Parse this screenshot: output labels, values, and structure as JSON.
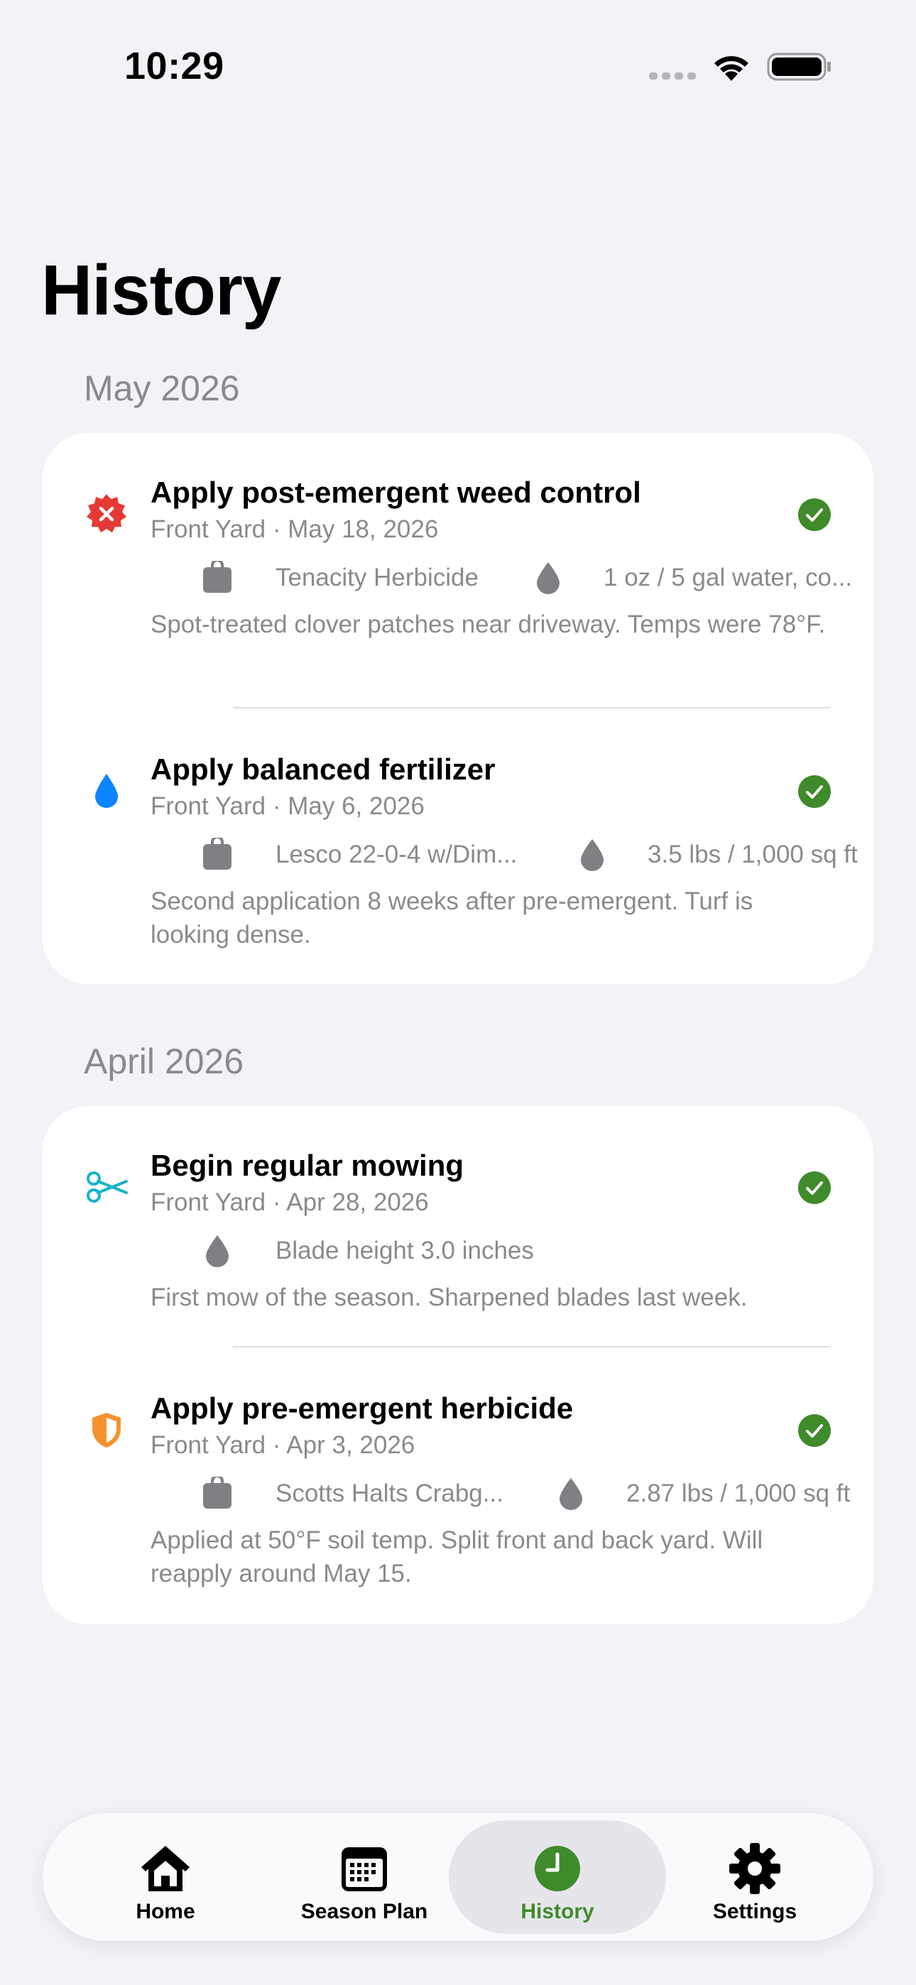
{
  "status_bar": {
    "time": "10:29"
  },
  "title": "History",
  "sections": [
    {
      "header": "May 2026",
      "entries": [
        {
          "icon": "weed-control-icon",
          "title": "Apply post-emergent weed control",
          "subtitle": "Front Yard · May 18, 2026",
          "product": "Tenacity Herbicide",
          "rate": "1 oz / 5 gal water, co...",
          "note": "Spot-treated clover patches near driveway. Temps were 78°F.",
          "status": "completed"
        },
        {
          "icon": "fertilizer-drop-icon",
          "title": "Apply balanced fertilizer",
          "subtitle": "Front Yard · May 6, 2026",
          "product": "Lesco 22-0-4 w/Dim...",
          "rate": "3.5 lbs / 1,000 sq ft",
          "note": "Second application 8 weeks after pre-emergent. Turf is looking dense.",
          "status": "completed"
        }
      ]
    },
    {
      "header": "April 2026",
      "entries": [
        {
          "icon": "scissors-icon",
          "title": "Begin regular mowing",
          "subtitle": "Front Yard · Apr 28, 2026",
          "rate": "Blade height 3.0 inches",
          "note": "First mow of the season. Sharpened blades last week.",
          "status": "completed"
        },
        {
          "icon": "shield-icon",
          "title": "Apply pre-emergent herbicide",
          "subtitle": "Front Yard · Apr 3, 2026",
          "product": "Scotts Halts Crabg...",
          "rate": "2.87 lbs / 1,000 sq ft",
          "note": "Applied at 50°F soil temp. Split front and back yard. Will reapply around May 15.",
          "status": "completed"
        }
      ]
    }
  ],
  "tabs": [
    {
      "label": "Home",
      "icon": "house-icon"
    },
    {
      "label": "Season Plan",
      "icon": "calendar-icon"
    },
    {
      "label": "History",
      "icon": "clock-icon",
      "selected": true
    },
    {
      "label": "Settings",
      "icon": "gear-icon"
    }
  ],
  "colors": {
    "accent_green": "#3f8a2b",
    "weed_red": "#e53935",
    "water_blue": "#0a84ff",
    "mow_cyan": "#17b3c9",
    "shield_orange": "#f5922e",
    "secondary_text": "#8a8a8e",
    "background": "#f2f2f7"
  }
}
